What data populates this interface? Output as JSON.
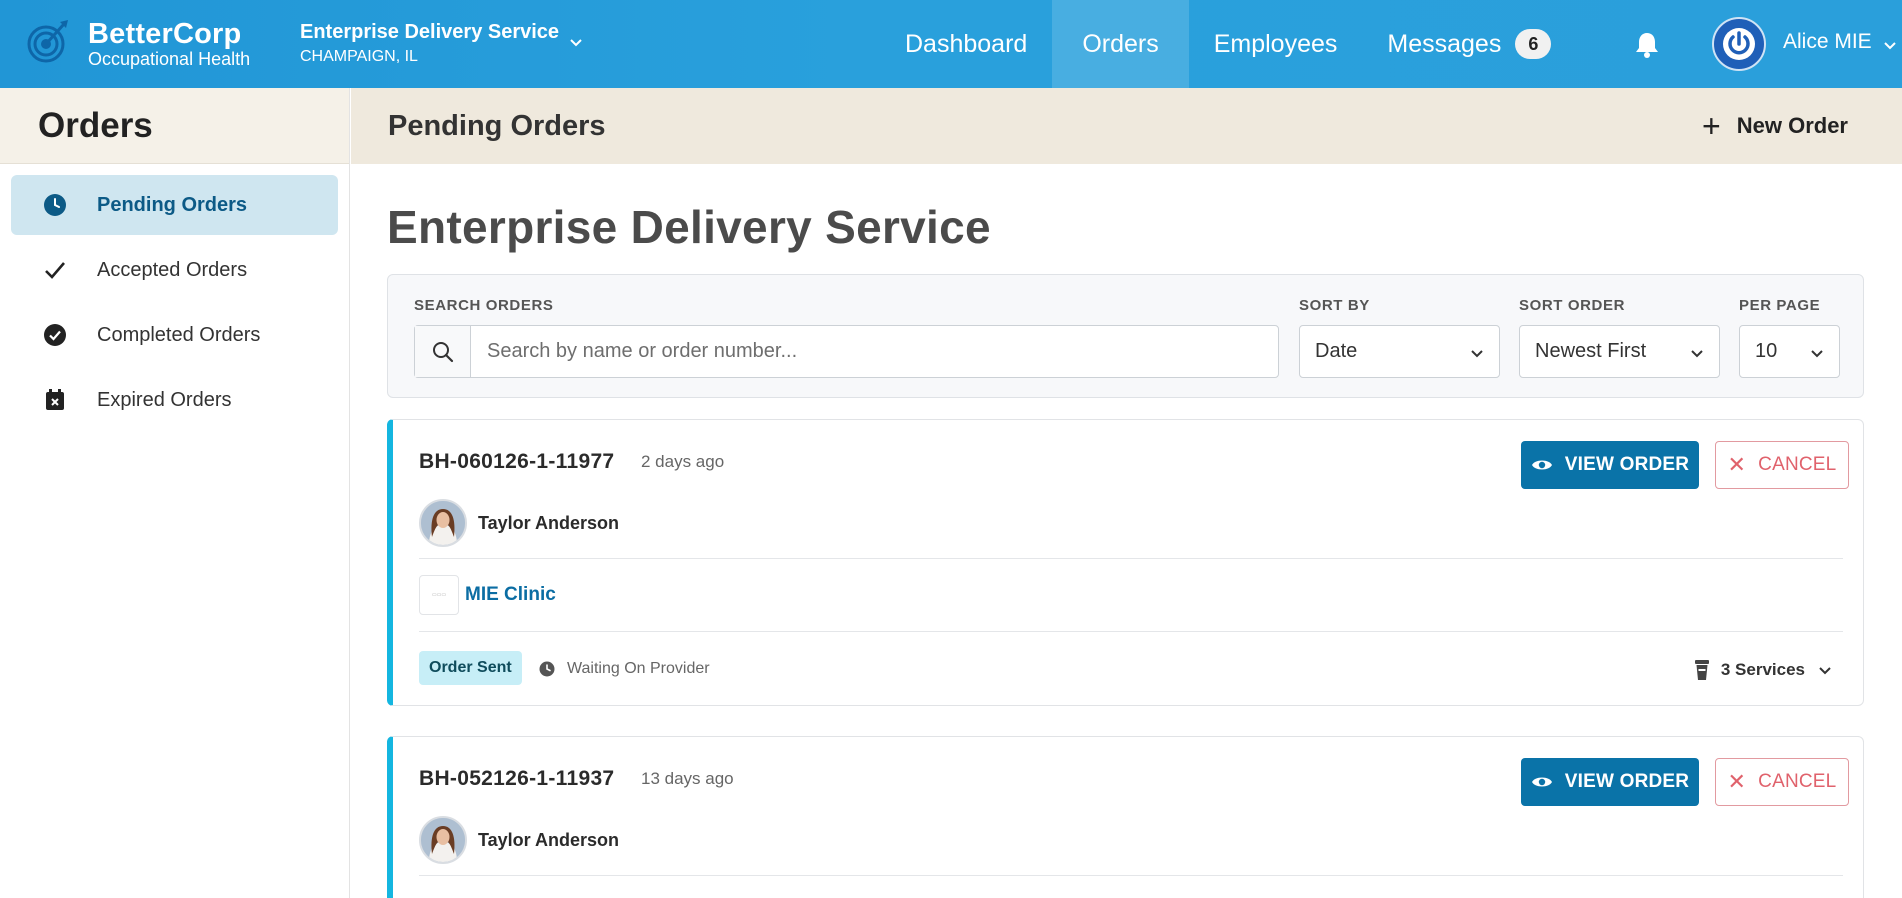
{
  "brand": {
    "name": "BetterCorp",
    "subtitle": "Occupational Health"
  },
  "organization": {
    "name": "Enterprise Delivery Service",
    "location": "CHAMPAIGN, IL"
  },
  "nav": {
    "dashboard": "Dashboard",
    "orders": "Orders",
    "employees": "Employees",
    "messages": "Messages",
    "messages_count": "6",
    "active": "Orders"
  },
  "user": {
    "name": "Alice MIE"
  },
  "sidebar": {
    "title": "Orders",
    "items": [
      {
        "label": "Pending Orders",
        "icon": "clock-icon",
        "active": true
      },
      {
        "label": "Accepted Orders",
        "icon": "check-icon",
        "active": false
      },
      {
        "label": "Completed Orders",
        "icon": "check-circle-icon",
        "active": false
      },
      {
        "label": "Expired Orders",
        "icon": "calendar-x-icon",
        "active": false
      }
    ]
  },
  "main": {
    "title": "Pending Orders",
    "new_order_label": "New Order",
    "heading": "Enterprise Delivery Service"
  },
  "filters": {
    "search_label": "SEARCH ORDERS",
    "search_placeholder": "Search by name or order number...",
    "search_value": "",
    "sort_by_label": "SORT BY",
    "sort_by_value": "Date",
    "sort_order_label": "SORT ORDER",
    "sort_order_value": "Newest First",
    "per_page_label": "PER PAGE",
    "per_page_value": "10"
  },
  "orders": [
    {
      "number": "BH-060126-1-11977",
      "age": "2 days ago",
      "view_label": "VIEW ORDER",
      "cancel_label": "CANCEL",
      "employee": "Taylor Anderson",
      "clinic": "MIE Clinic",
      "status": "Order Sent",
      "waiting": "Waiting On Provider",
      "services": "3 Services"
    },
    {
      "number": "BH-052126-1-11937",
      "age": "13 days ago",
      "view_label": "VIEW ORDER",
      "cancel_label": "CANCEL",
      "employee": "Taylor Anderson"
    }
  ],
  "colors": {
    "nav_bg": "#2a9fdb",
    "accent": "#0a73a8",
    "card_border": "#14b6e0",
    "cancel": "#e0626c",
    "status_badge_bg": "#c7eef7",
    "sidebar_active_bg": "#cfe6f0"
  }
}
